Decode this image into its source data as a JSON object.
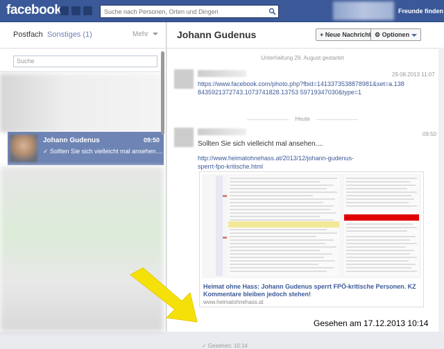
{
  "topbar": {
    "logo": "facebook",
    "search_placeholder": "Suche nach Personen, Orten und Dingen",
    "friends": "Freunde finden"
  },
  "left": {
    "tab_inbox": "Postfach",
    "tab_other": "Sonstiges (1)",
    "tab_more": "Mehr",
    "search_placeholder": "Suche",
    "conversation": {
      "name": "Johann Gudenus",
      "time": "09:50",
      "snippet": "✓ Sollten Sie sich vielleicht mal ansehen...."
    }
  },
  "header": {
    "title": "Johann Gudenus",
    "new_message": "+ Neue Nachricht",
    "options": "⚙ Optionen"
  },
  "messages": {
    "started": "Unterhaltung 29. August gestartet",
    "m1_time": "29.08.2013 11:07",
    "m1_link": "https://www.facebook.com/photo.php?fbid=1413373538878981&set=a.1388435921372743.1073741828.13753 59719347030&type=1",
    "today": "Heute",
    "m2_time": "09:50",
    "m2_text": "Sollten Sie sich vielleicht mal ansehen....",
    "m2_link": "http://www.heimatohnehass.at/2013/12/johann-gudenus-sperrt-fpo-kritische.html",
    "card_title": "Heimat ohne Hass: Johann Gudenus sperrt FPÖ-kritische Personen. KZ Kommentare bleiben jedoch stehen!",
    "card_domain": "www.heimatohnehass.at",
    "seen": "✓ Gesehen: 10:14"
  },
  "caption": "Gesehen am 17.12.2013 10:14",
  "colors": {
    "brand": "#3b5998",
    "selected": "#6d84b4",
    "arrow": "#f5e10a"
  }
}
